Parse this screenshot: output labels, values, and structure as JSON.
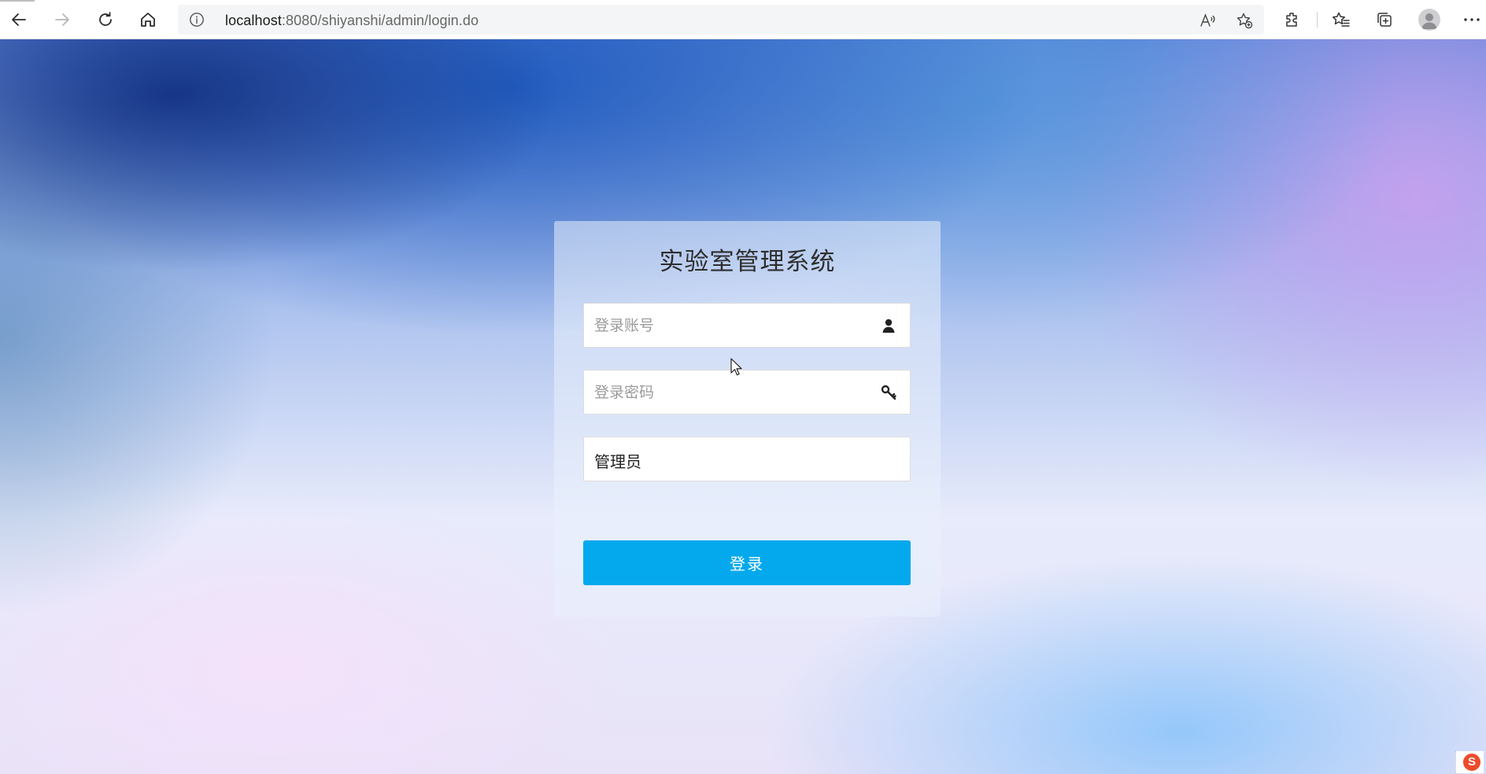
{
  "browser": {
    "url_host": "localhost",
    "url_path": ":8080/shiyanshi/admin/login.do"
  },
  "login": {
    "title": "实验室管理系统",
    "account_placeholder": "登录账号",
    "account_value": "",
    "password_placeholder": "登录密码",
    "password_value": "",
    "role_selected": "管理员",
    "submit_label": "登录"
  },
  "tray": {
    "badge_letter": "S"
  },
  "colors": {
    "primary_button": "#03a9ec",
    "badge": "#ee4b2b"
  },
  "icons": [
    "back-icon",
    "forward-icon",
    "refresh-icon",
    "home-icon",
    "info-icon",
    "read-aloud-icon",
    "add-favorite-icon",
    "extensions-icon",
    "favorites-icon",
    "collections-icon",
    "profile-icon",
    "more-icon",
    "user-icon",
    "key-icon"
  ]
}
